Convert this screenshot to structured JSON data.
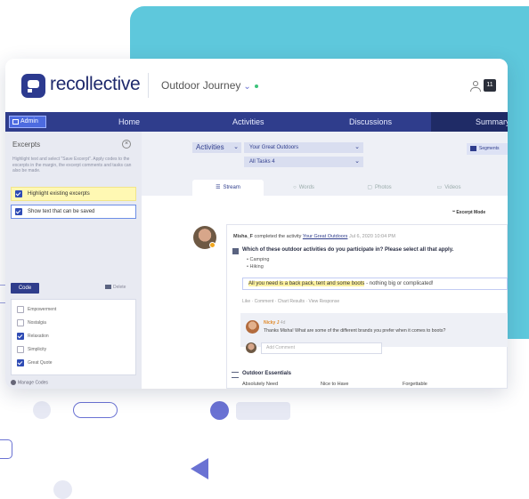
{
  "app": {
    "logo_text": "recollective",
    "project_name": "Outdoor Journey",
    "project_chevron": "⌄",
    "notification_count": "11"
  },
  "nav": {
    "admin": "Admin",
    "home": "Home",
    "activities": "Activities",
    "discussions": "Discussions",
    "summary": "Summary"
  },
  "sidebar": {
    "title": "Excerpts",
    "description": "Highlight text and select \"Save Excerpt\". Apply codes to the excerpts in the margin, the excerpt comments and tasks can also be made.",
    "options": [
      {
        "label": "Highlight existing excerpts",
        "checked": true
      },
      {
        "label": "Show text that can be saved",
        "checked": true
      }
    ],
    "code_button": "Code",
    "delete_label": "Delete",
    "codes": [
      {
        "label": "Empowerment",
        "checked": false
      },
      {
        "label": "Nostalgia",
        "checked": false
      },
      {
        "label": "Relaxation",
        "checked": true
      },
      {
        "label": "Simplicity",
        "checked": false
      },
      {
        "label": "Great Quote",
        "checked": true
      }
    ],
    "manage_codes": "Manage Codes"
  },
  "filters": {
    "activities": "Activities",
    "activity_select": "Your Great Outdoors",
    "task_select": "All Tasks",
    "task_count": "4",
    "segments": "Segments"
  },
  "tabs": {
    "stream": "Stream",
    "words": "Words",
    "photos": "Photos",
    "videos": "Videos"
  },
  "excerpt_mode": "Excerpt Mode",
  "post": {
    "author": "Misha_F",
    "action": "completed the activity",
    "activity_link": "Your Great Outdoors",
    "date": "Jul 6, 2020 10:04 PM",
    "question": "Which of these outdoor activities do you participate in? Please select all that apply.",
    "bullets": [
      "Camping",
      "Hiking"
    ],
    "answer_highlight": "All you need is a back pack, tent and some boots",
    "answer_rest": "- nothing big or complicated!",
    "actions": "Like · Comment · Chart Results · View Response"
  },
  "reply": {
    "name": "Nicky J",
    "time": "4d",
    "text": "Thanks Misha! What are some of the different brands you prefer when it comes to boots?"
  },
  "comment_placeholder": "Add Comment",
  "essentials": {
    "title": "Outdoor Essentials",
    "columns": [
      "Absolutely Need",
      "Nice to Have",
      "Forgettable"
    ]
  }
}
